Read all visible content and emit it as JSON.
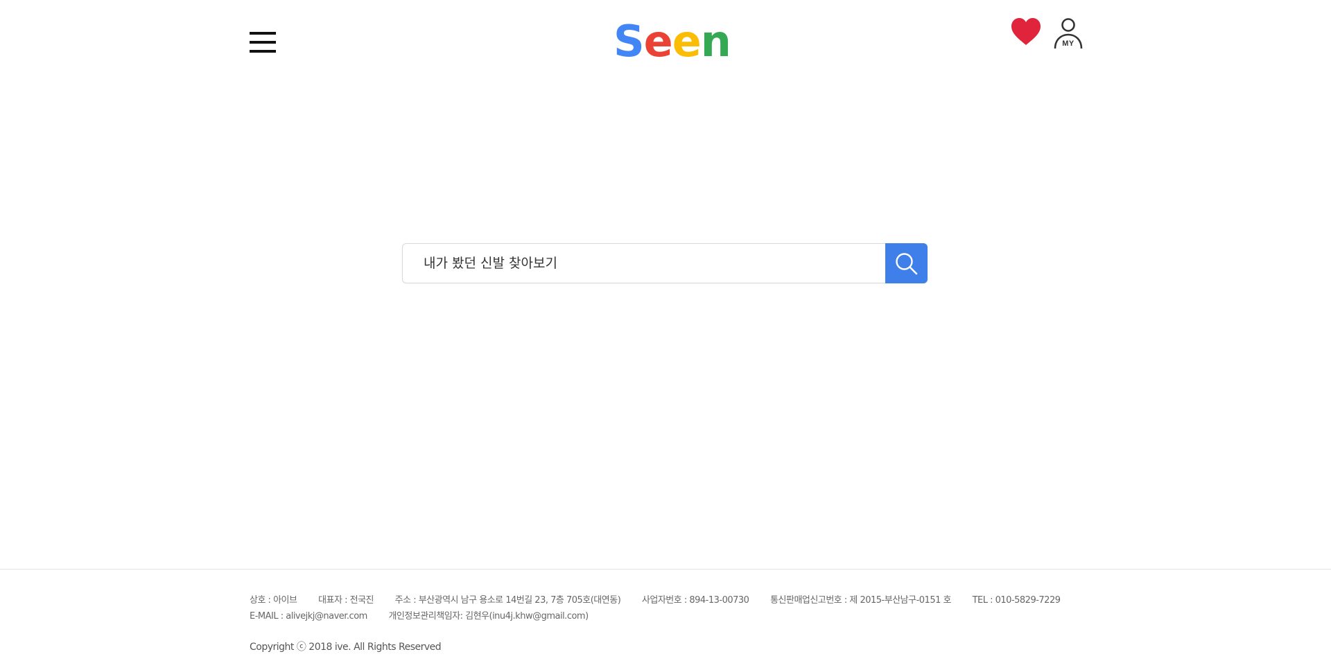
{
  "header": {
    "menu_icon": "hamburger-menu-icon",
    "logo": {
      "letters": [
        {
          "char": "S",
          "color": "#4285f4"
        },
        {
          "char": "e",
          "color": "#ea4335"
        },
        {
          "char": "e",
          "color": "#fbbc05"
        },
        {
          "char": "n",
          "color": "#34a853"
        }
      ]
    },
    "wishlist_icon": "heart-icon",
    "wishlist_color": "#e0243c",
    "my_icon": "user-icon",
    "my_label": "MY"
  },
  "search": {
    "placeholder": "내가 봤던 신발 찾아보기",
    "button_icon": "search-icon",
    "button_color": "#3f7fea"
  },
  "footer": {
    "row1": [
      "상호 : 아이브",
      "대표자 : 전국진",
      "주소 : 부산광역시 남구 용소로 14번길 23, 7층 705호(대연동)",
      "사업자번호 : 894-13-00730",
      "통신판매업신고번호 : 제 2015-부산남구-0151 호",
      "TEL : 010-5829-7229"
    ],
    "row2": [
      "E-MAIL : alivejkj@naver.com",
      "개인정보관리책임자: 김현우(inu4j.khw@gmail.com)"
    ],
    "copyright": "Copyright ⓒ 2018 ive. All Rights Reserved"
  }
}
